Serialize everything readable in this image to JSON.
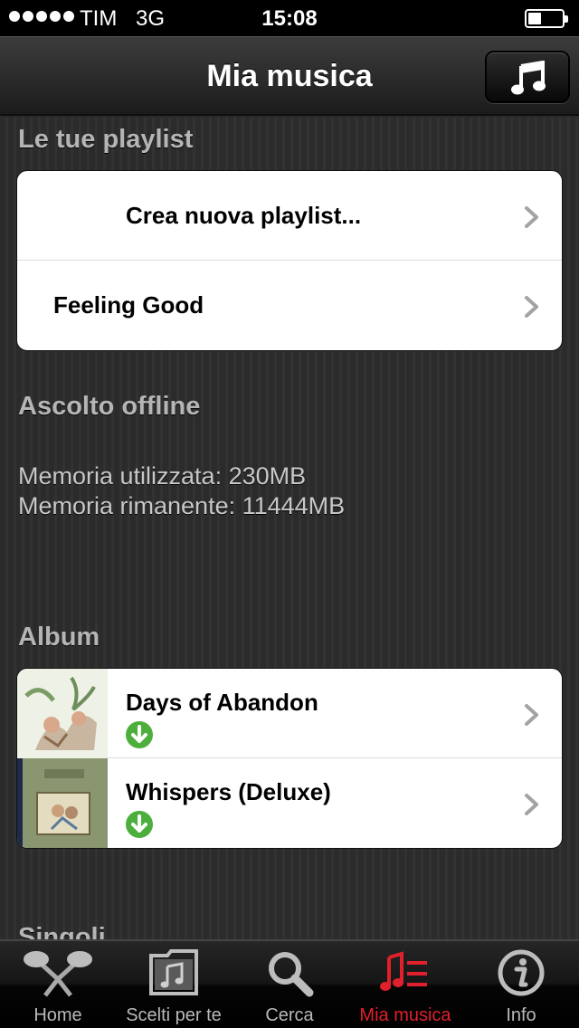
{
  "status_bar": {
    "carrier": "TIM",
    "network": "3G",
    "time": "15:08"
  },
  "nav": {
    "title": "Mia musica",
    "right_icon": "music-note-icon"
  },
  "playlists": {
    "section_title": "Le tue playlist",
    "items": [
      {
        "label": "Crea nuova playlist..."
      },
      {
        "label": "Feeling Good"
      }
    ]
  },
  "offline": {
    "section_title": "Ascolto offline",
    "memory_used": "Memoria utilizzata: 230MB",
    "memory_remaining": "Memoria rimanente: 11444MB"
  },
  "albums": {
    "section_title": "Album",
    "items": [
      {
        "title": "Days of Abandon",
        "downloaded": true
      },
      {
        "title": "Whispers (Deluxe)",
        "downloaded": true
      }
    ]
  },
  "singles": {
    "section_title": "Singoli"
  },
  "tabs": [
    {
      "label": "Home",
      "icon": "microphones-icon",
      "active": false
    },
    {
      "label": "Scelti per te",
      "icon": "music-folder-icon",
      "active": false
    },
    {
      "label": "Cerca",
      "icon": "search-icon",
      "active": false
    },
    {
      "label": "Mia musica",
      "icon": "my-music-icon",
      "active": true
    },
    {
      "label": "Info",
      "icon": "info-icon",
      "active": false
    }
  ],
  "colors": {
    "accent": "#e0202c",
    "download": "#4caf3c"
  }
}
